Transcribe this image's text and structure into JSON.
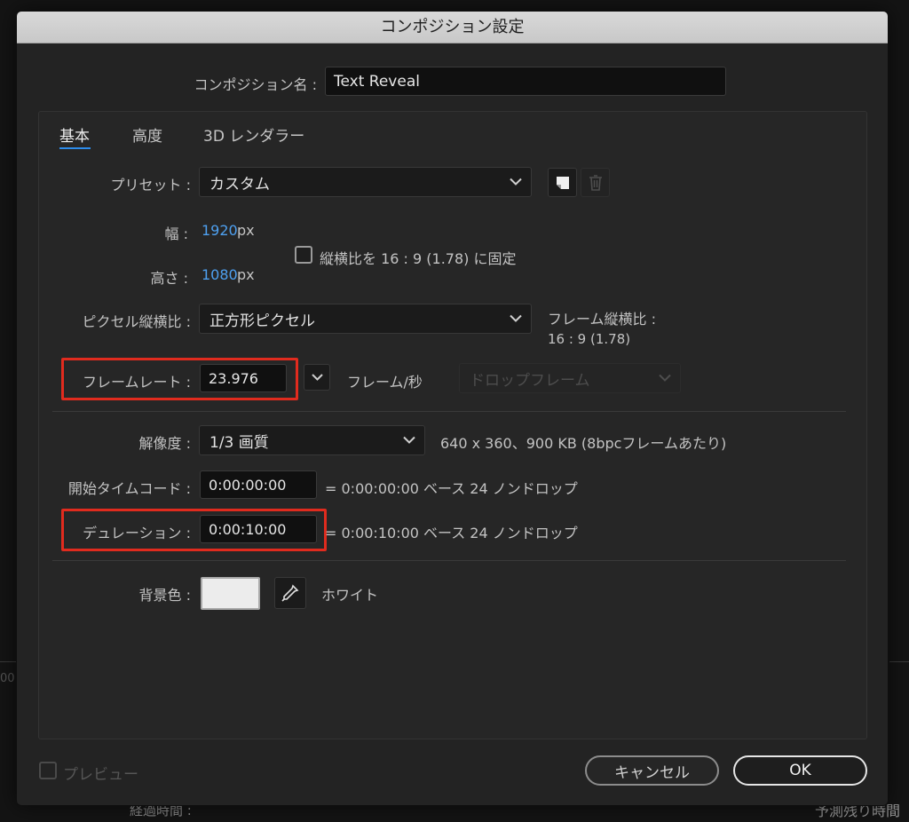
{
  "dialog": {
    "title": "コンポジション設定",
    "comp_name_label": "コンポジション名 :",
    "comp_name_value": "Text Reveal"
  },
  "tabs": [
    {
      "label": "基本",
      "active": true
    },
    {
      "label": "高度",
      "active": false
    },
    {
      "label": "3D レンダラー",
      "active": false
    }
  ],
  "basic": {
    "preset_label": "プリセット :",
    "preset_value": "カスタム",
    "width_label": "幅 :",
    "width_value": "1920",
    "width_unit": "px",
    "height_label": "高さ :",
    "height_value": "1080",
    "height_unit": "px",
    "lock_aspect_label": "縦横比を 16 : 9 (1.78) に固定",
    "lock_aspect_checked": false,
    "pixel_aspect_label": "ピクセル縦横比 :",
    "pixel_aspect_value": "正方形ピクセル",
    "frame_aspect_label": "フレーム縦横比 :",
    "frame_aspect_value": "16 : 9 (1.78)",
    "frame_rate_label": "フレームレート :",
    "frame_rate_value": "23.976",
    "frame_rate_unit": "フレーム/秒",
    "drop_frame_value": "ドロップフレーム",
    "resolution_label": "解像度 :",
    "resolution_value": "1/3 画質",
    "resolution_info": "640 x 360、900 KB (8bpcフレームあたり)",
    "start_tc_label": "開始タイムコード :",
    "start_tc_value": "0:00:00:00",
    "start_tc_info": "= 0:00:00:00  ベース 24  ノンドロップ",
    "duration_label": "デュレーション :",
    "duration_value": "0:00:10:00",
    "duration_info": "= 0:00:10:00  ベース 24  ノンドロップ",
    "bg_color_label": "背景色 :",
    "bg_color_name": "ホワイト",
    "bg_color_hex": "#ececec"
  },
  "footer": {
    "preview_label": "プレビュー",
    "cancel_label": "キャンセル",
    "ok_label": "OK"
  },
  "background": {
    "left_fragment": "00",
    "bottom_left": "経過時間 :",
    "bottom_right": "予測残り時間"
  },
  "colors": {
    "accent": "#2d8ceb",
    "value_blue": "#4ea0f0",
    "highlight_red": "#e02b1e"
  }
}
